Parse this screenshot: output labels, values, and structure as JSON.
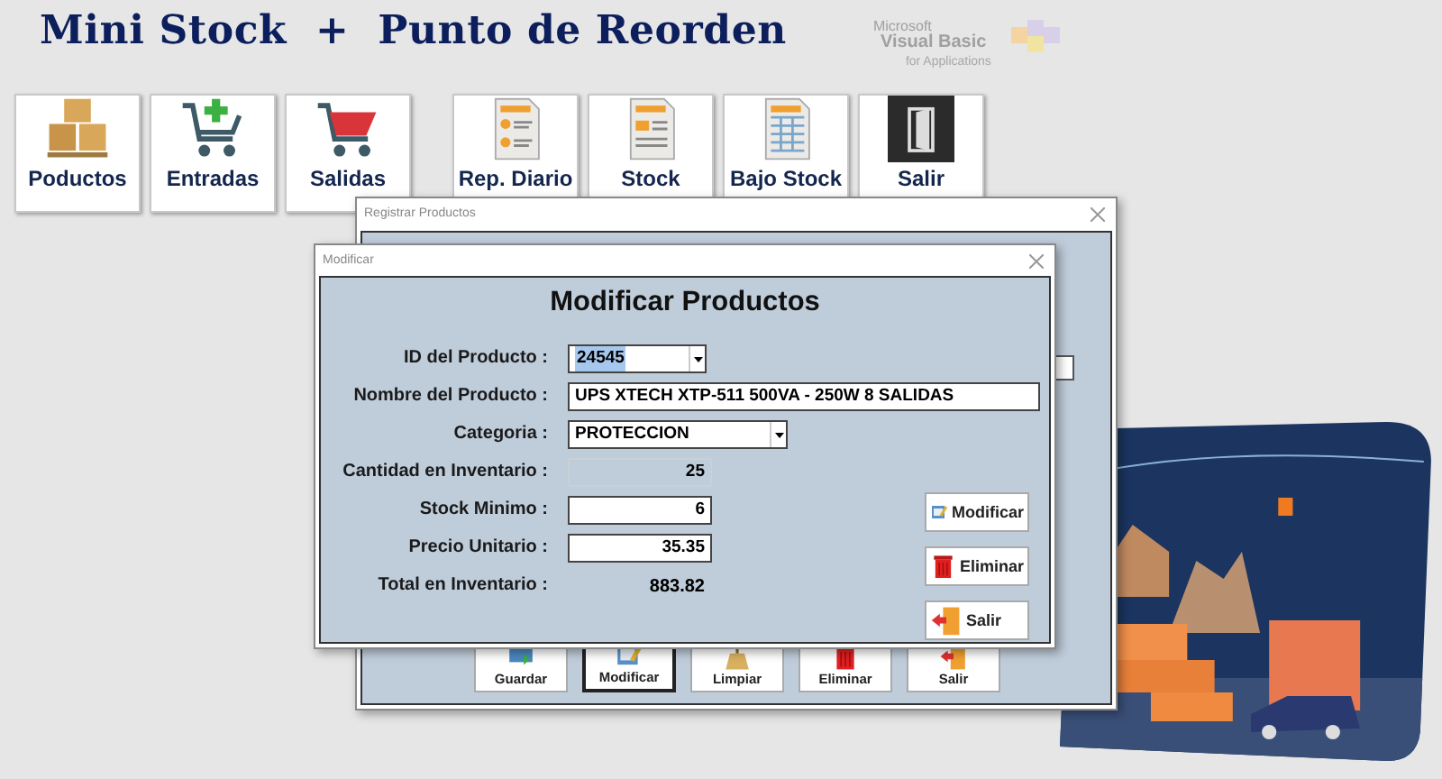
{
  "app_title": "Mini Stock  +  Punto de Reorden",
  "vba_logo": {
    "brand": "Microsoft",
    "product": "Visual Basic",
    "suffix": "for Applications"
  },
  "toolbar": [
    {
      "label": "Poductos",
      "kind": "boxes"
    },
    {
      "label": "Entradas",
      "kind": "cart-add"
    },
    {
      "label": "Salidas",
      "kind": "cart"
    },
    {
      "label": "Rep. Diario",
      "kind": "report"
    },
    {
      "label": "Stock",
      "kind": "document"
    },
    {
      "label": "Bajo Stock",
      "kind": "table"
    },
    {
      "label": "Salir",
      "kind": "exit"
    }
  ],
  "register_window": {
    "title": "Registrar  Productos",
    "buttons": [
      {
        "label": "Guardar",
        "kind": "save",
        "selected": false
      },
      {
        "label": "Modificar",
        "kind": "edit",
        "selected": true
      },
      {
        "label": "Limpiar",
        "kind": "broom",
        "selected": false
      },
      {
        "label": "Eliminar",
        "kind": "trash",
        "selected": false
      },
      {
        "label": "Salir",
        "kind": "exit",
        "selected": false
      }
    ]
  },
  "modify_window": {
    "title": "Modificar",
    "heading": "Modificar Productos",
    "fields": [
      {
        "label": "ID del Producto :",
        "value": "24545",
        "kind": "dropdown",
        "highlighted": true
      },
      {
        "label": "Nombre del Producto :",
        "value": "UPS XTECH XTP-511 500VA - 250W 8 SALIDAS",
        "kind": "wide"
      },
      {
        "label": "Categoria :",
        "value": "PROTECCION",
        "kind": "dropdown",
        "highlighted": false
      },
      {
        "label": "Cantidad en Inventario :",
        "value": "25",
        "kind": "readonly"
      },
      {
        "label": "Stock Minimo :",
        "value": "6",
        "kind": "number"
      },
      {
        "label": "Precio Unitario :",
        "value": "35.35",
        "kind": "number"
      },
      {
        "label": "Total en Inventario :",
        "value": "883.82",
        "kind": "display"
      }
    ],
    "buttons": [
      {
        "label": "Modificar",
        "kind": "edit"
      },
      {
        "label": "Eliminar",
        "kind": "trash"
      },
      {
        "label": "Salir",
        "kind": "exit"
      }
    ]
  }
}
